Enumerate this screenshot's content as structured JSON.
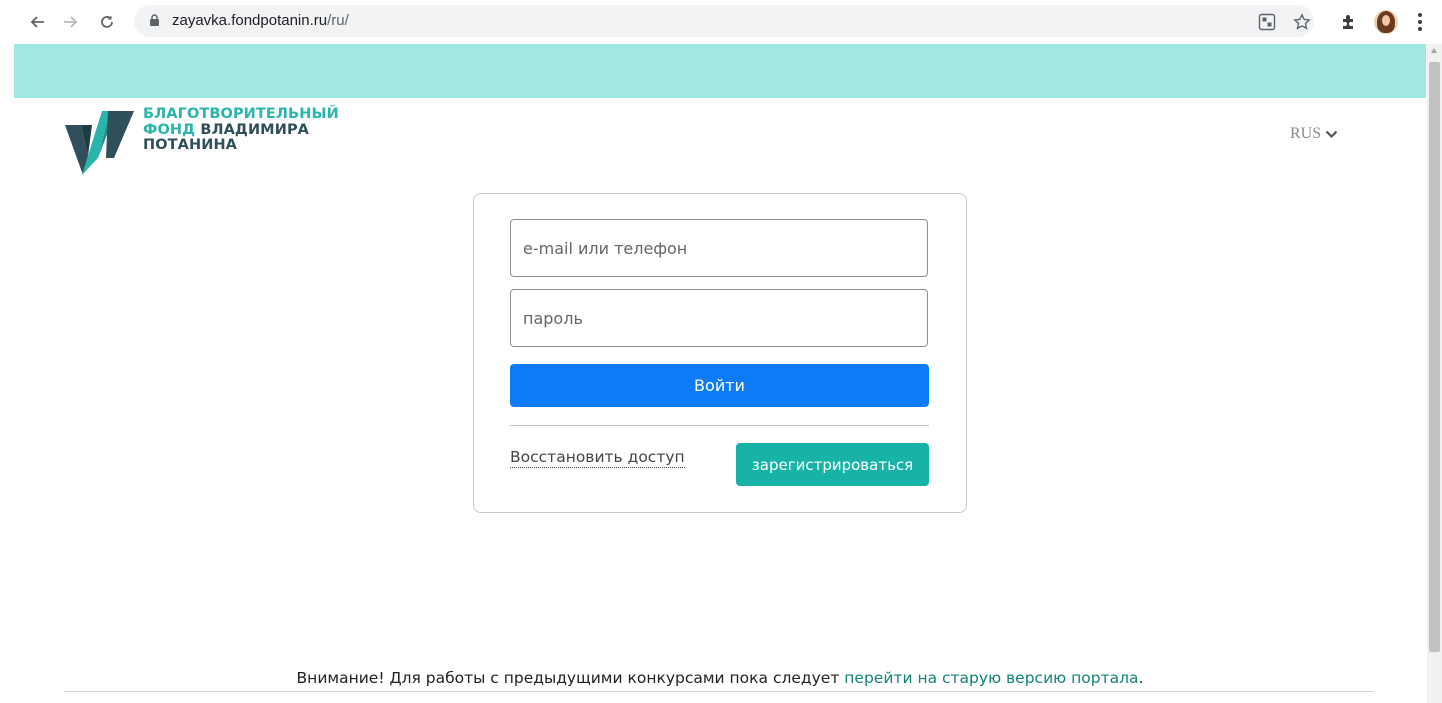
{
  "browser": {
    "url_domain": "zayavka.fondpotanin.ru",
    "url_path": "/ru/",
    "icons": [
      "back-icon",
      "forward-icon",
      "reload-icon",
      "lock-icon",
      "translate-icon",
      "star-icon",
      "extensions-icon",
      "profile-avatar",
      "menu-icon"
    ]
  },
  "header": {
    "band_color": "#a3e8e0",
    "logo": {
      "line1": "БЛАГОТВОРИТЕЛЬНЫЙ",
      "line2a": "ФОНД",
      "line2b": "ВЛАДИМИРА",
      "line3": "ПОТАНИНА"
    },
    "language": "RUS"
  },
  "login": {
    "email_placeholder": "e-mail или телефон",
    "password_placeholder": "пароль",
    "login_button": "Войти",
    "restore_link": "Восстановить доступ",
    "register_button": "зарегистрироваться"
  },
  "footer": {
    "notice_text": "Внимание! Для работы с предыдущими конкурсами пока следует ",
    "notice_link": "перейти на старую версию портала",
    "notice_end": "."
  },
  "colors": {
    "primary_button": "#0d7bf5",
    "register_button": "#18b3a7",
    "link": "#138377"
  }
}
